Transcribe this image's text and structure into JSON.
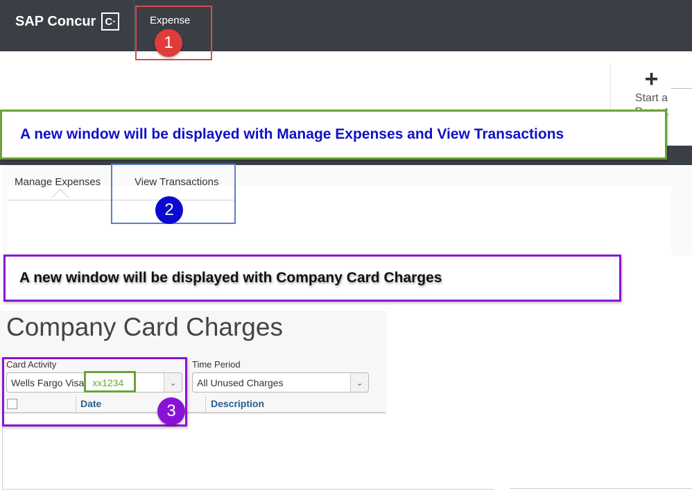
{
  "topbar": {
    "brand": "SAP Concur",
    "brand_logo_glyph": "C·",
    "nav_items": [
      {
        "label": "Expense"
      }
    ]
  },
  "panel": {
    "start_report_icon": "plus-icon",
    "start_report_label_line1": "Start a",
    "start_report_label_line2": "Report"
  },
  "tabs": [
    {
      "label": "Manage Expenses",
      "active": true
    },
    {
      "label": "View Transactions",
      "active": false
    }
  ],
  "company_card": {
    "title": "Company Card Charges",
    "card_activity": {
      "label": "Card Activity",
      "value_name": "Wells Fargo Visa",
      "value_number": "xx1234"
    },
    "time_period": {
      "label": "Time Period",
      "value": "All Unused Charges"
    },
    "columns": [
      "Date",
      "Description"
    ]
  },
  "annotations": {
    "step1": "1",
    "step2": "2",
    "step3": "3",
    "callout_views": "A new window will be displayed with Manage Expenses and View Transactions",
    "callout_cards": "A new window will be displayed with Company Card Charges",
    "colors": {
      "step1": "#e03c3c",
      "step2": "#0a0ad0",
      "step3": "#8a12d6",
      "callout_green_border": "#6aa339",
      "callout_purple_border": "#8a12d6",
      "callout_blue_text": "#1010c8"
    }
  }
}
